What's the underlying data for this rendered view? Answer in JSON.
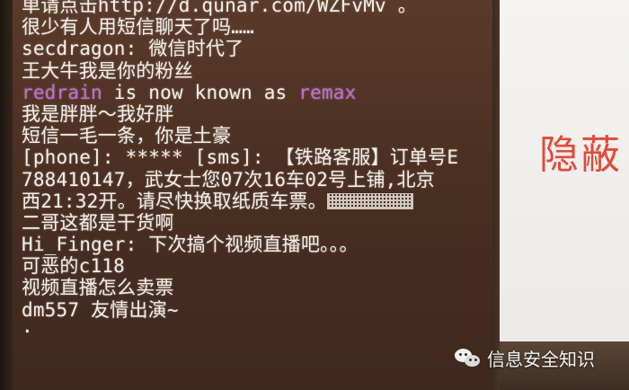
{
  "terminal": {
    "lines": [
      "单请点击http://d.qunar.com/WZFvMv 。",
      "很少有人用短信聊天了吗……",
      "secdragon: 微信时代了",
      "王大牛我是你的粉丝",
      "",
      "我是胖胖～我好胖",
      "短信一毛一条，你是土豪",
      "[phone]: ***** [sms]: 【铁路客服】订单号E",
      "788410147，武女士您07次16车02号上铺,北京",
      "西21:32开。请尽快换取纸质车票。",
      "二哥这都是干货啊",
      "Hi_Finger: 下次搞个视频直播吧。。。",
      "可恶的c118",
      "视频直播怎么卖票",
      "dm557 友情出演~",
      "·"
    ],
    "nick_change": {
      "old_nick": "redrain",
      "middle": " is now known as ",
      "new_nick": "remax"
    },
    "colors": {
      "text": "#f2efe8",
      "nick": "#c46ad8",
      "background": "#4b2f22"
    }
  },
  "slide": {
    "title": "隐蔽",
    "title_color": "#e04a3c"
  },
  "watermark": {
    "icon": "wechat-icon",
    "text": "信息安全知识"
  }
}
